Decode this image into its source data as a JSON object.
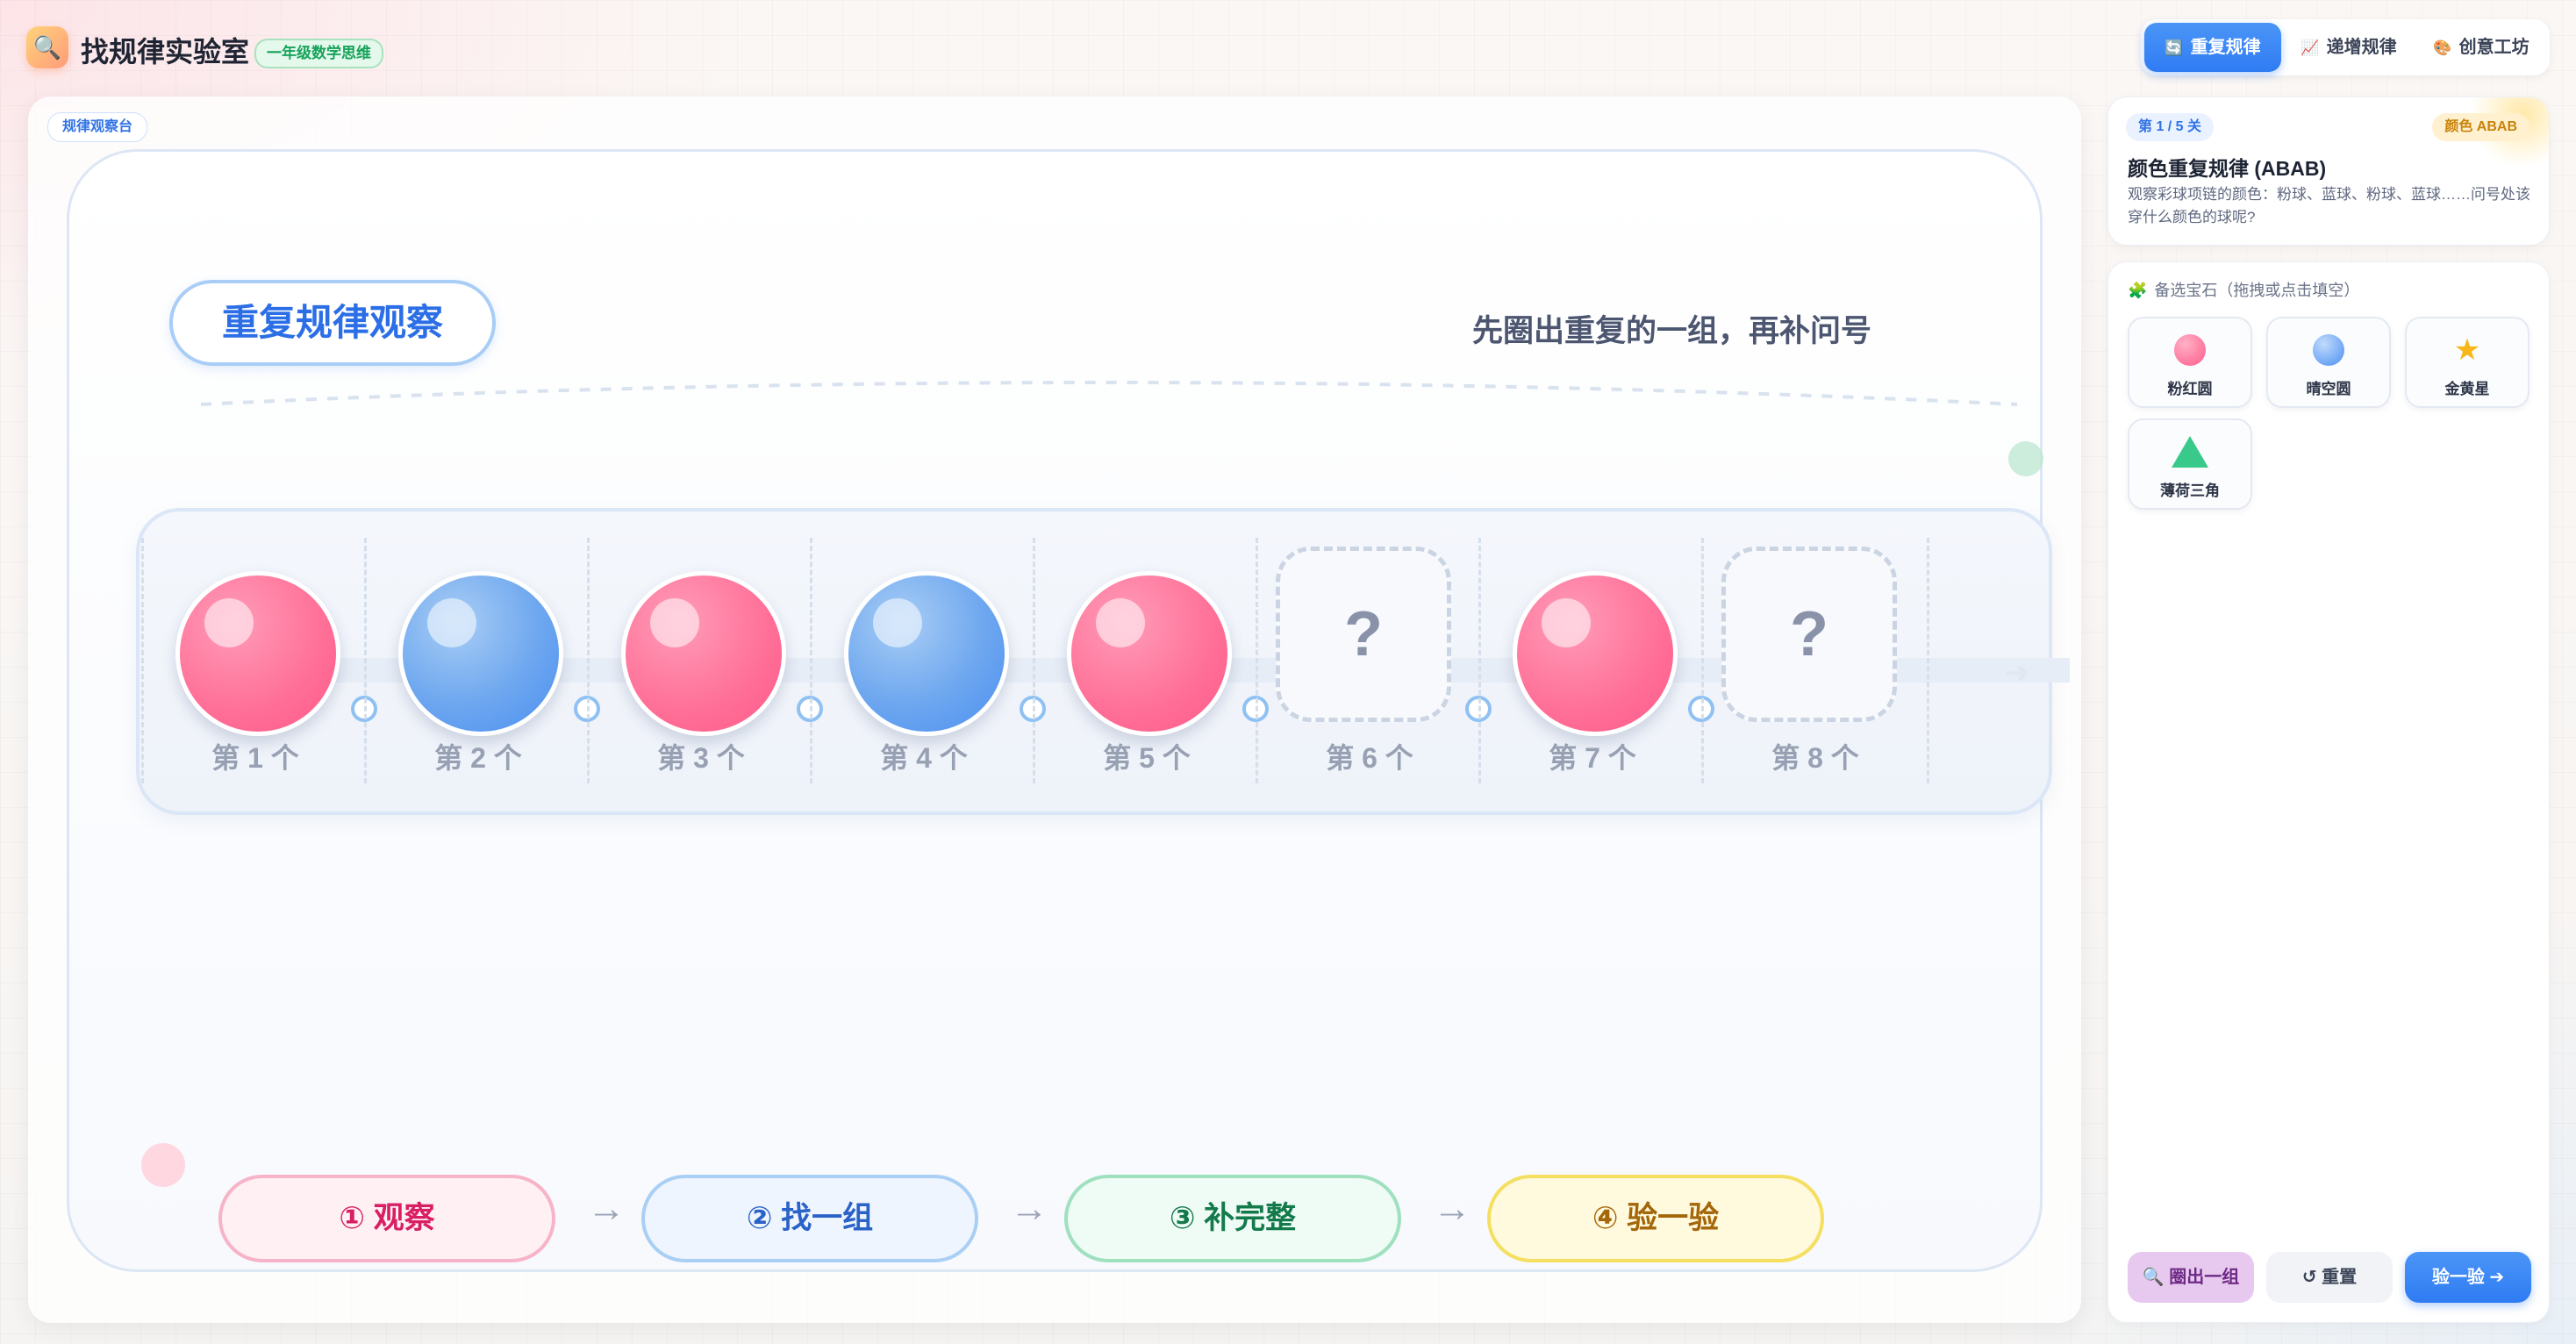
{
  "app": {
    "title": "找规律实验室",
    "grade_badge": "一年级数学思维",
    "logo_icon": "🔍"
  },
  "mode_tabs": [
    {
      "icon": "🔄",
      "label": "重复规律",
      "active": true
    },
    {
      "icon": "📈",
      "label": "递增规律",
      "active": false
    },
    {
      "icon": "🎨",
      "label": "创意工坊",
      "active": false
    }
  ],
  "stage": {
    "tag": "规律观察台",
    "title": "重复规律观察",
    "hint": "先圈出重复的一组，再补问号",
    "sequence": [
      {
        "kind": "ball",
        "color": "pink",
        "label": "第 1 个"
      },
      {
        "kind": "ball",
        "color": "blue",
        "label": "第 2 个"
      },
      {
        "kind": "ball",
        "color": "pink",
        "label": "第 3 个"
      },
      {
        "kind": "ball",
        "color": "blue",
        "label": "第 4 个"
      },
      {
        "kind": "ball",
        "color": "pink",
        "label": "第 5 个"
      },
      {
        "kind": "blank",
        "symbol": "?",
        "label": "第 6 个"
      },
      {
        "kind": "ball",
        "color": "pink",
        "label": "第 7 个"
      },
      {
        "kind": "blank",
        "symbol": "?",
        "label": "第 8 个"
      }
    ],
    "steps": [
      "① 观察",
      "② 找一组",
      "③ 补完整",
      "④ 验一验"
    ],
    "step_arrow": "→"
  },
  "level": {
    "progress": "第 1 / 5 关",
    "type": "颜色 ABAB",
    "title": "颜色重复规律 (ABAB)",
    "description": "观察彩球项链的颜色：粉球、蓝球、粉球、蓝球……问号处该穿什么颜色的球呢?"
  },
  "gems": {
    "heading_icon": "🧩",
    "heading": "备选宝石（拖拽或点击填空）",
    "items": [
      {
        "icon": "pink-ball",
        "label": "粉红圆"
      },
      {
        "icon": "blue-ball",
        "label": "晴空圆"
      },
      {
        "icon": "gold-star",
        "label": "金黄星"
      },
      {
        "icon": "mint-triangle",
        "label": "薄荷三角"
      }
    ]
  },
  "actions": {
    "circle_group": "🔍 圈出一组",
    "reset": "↺ 重置",
    "check": "验一验 ➔"
  },
  "colors": {
    "accent": "#2f7cf3",
    "pink_ball": "#ff6f97",
    "blue_ball": "#4a8ff2",
    "step1": "#d81f63",
    "step2": "#2b62c8",
    "step3": "#137a4b",
    "step4": "#a36608"
  },
  "star_glyph": "★"
}
